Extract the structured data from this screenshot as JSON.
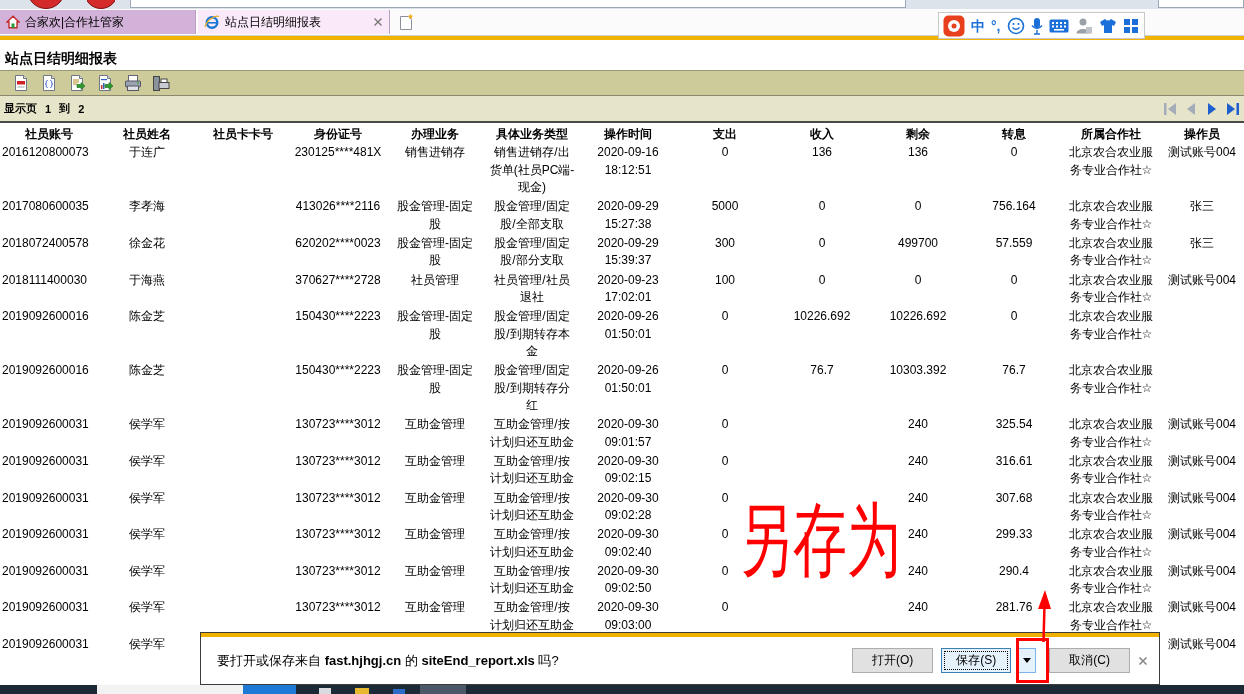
{
  "browser": {
    "tabs": [
      {
        "label": "合家欢|合作社管家",
        "selected": false
      },
      {
        "label": "站点日结明细报表",
        "selected": true
      }
    ]
  },
  "ime_bar": {
    "mode": "中",
    "punctuation": "°,"
  },
  "page_title": "站点日结明细报表",
  "pager": {
    "prefix": "显示页",
    "current": "1",
    "separator": "到",
    "total": "2",
    "nav": [
      {
        "kind": "first",
        "disabled": true
      },
      {
        "kind": "prev",
        "disabled": true
      },
      {
        "kind": "next",
        "disabled": false
      },
      {
        "kind": "last",
        "disabled": false
      }
    ]
  },
  "table": {
    "columns": [
      "社员账号",
      "社员姓名",
      "社员卡卡号",
      "身份证号",
      "办理业务",
      "具体业务类型",
      "操作时间",
      "支出",
      "收入",
      "剩余",
      "转息",
      "所属合作社",
      "操作员"
    ],
    "rows": [
      {
        "cells": [
          "2016120800073",
          "于连广",
          null,
          "230125****481X",
          "销售进销存",
          "销售进销存/出货单(社员PC端-现金)",
          "2020-09-16 18:12:51",
          "0",
          "136",
          "136",
          "0",
          "北京农合农业服务专业合作社☆",
          "测试账号004"
        ]
      },
      {
        "cells": [
          "2017080600035",
          "李孝海",
          null,
          "413026****2116",
          "股金管理-固定股",
          "股金管理/固定股/全部支取",
          "2020-09-29 15:27:38",
          "5000",
          "0",
          "0",
          "756.164",
          "北京农合农业服务专业合作社☆",
          "张三"
        ]
      },
      {
        "cells": [
          "2018072400578",
          "徐金花",
          null,
          "620202****0023",
          "股金管理-固定股",
          "股金管理/固定股/部分支取",
          "2020-09-29 15:39:37",
          "300",
          "0",
          "499700",
          "57.559",
          "北京农合农业服务专业合作社☆",
          "张三"
        ]
      },
      {
        "cells": [
          "2018111400030",
          "于海燕",
          null,
          "370627****2728",
          "社员管理",
          "社员管理/社员退社",
          "2020-09-23 17:02:01",
          "100",
          "0",
          "0",
          "0",
          "北京农合农业服务专业合作社☆",
          "测试账号004"
        ]
      },
      {
        "cells": [
          "2019092600016",
          "陈金芝",
          null,
          "150430****2223",
          "股金管理-固定股",
          "股金管理/固定股/到期转存本金",
          "2020-09-26 01:50:01",
          "0",
          "10226.692",
          "10226.692",
          "0",
          "北京农合农业服务专业合作社☆",
          null
        ]
      },
      {
        "cells": [
          "2019092600016",
          "陈金芝",
          null,
          "150430****2223",
          "股金管理-固定股",
          "股金管理/固定股/到期转存分红",
          "2020-09-26 01:50:01",
          "0",
          "76.7",
          "10303.392",
          "76.7",
          "北京农合农业服务专业合作社☆",
          null
        ]
      },
      {
        "cells": [
          "2019092600031",
          "侯学军",
          null,
          "130723****3012",
          "互助金管理",
          "互助金管理/按计划归还互助金",
          "2020-09-30 09:01:57",
          "0",
          null,
          "240",
          "325.54",
          "北京农合农业服务专业合作社☆",
          "测试账号004"
        ]
      },
      {
        "cells": [
          "2019092600031",
          "侯学军",
          null,
          "130723****3012",
          "互助金管理",
          "互助金管理/按计划归还互助金",
          "2020-09-30 09:02:15",
          "0",
          null,
          "240",
          "316.61",
          "北京农合农业服务专业合作社☆",
          "测试账号004"
        ]
      },
      {
        "cells": [
          "2019092600031",
          "侯学军",
          null,
          "130723****3012",
          "互助金管理",
          "互助金管理/按计划归还互助金",
          "2020-09-30 09:02:28",
          "0",
          null,
          "240",
          "307.68",
          "北京农合农业服务专业合作社☆",
          "测试账号004"
        ]
      },
      {
        "cells": [
          "2019092600031",
          "侯学军",
          null,
          "130723****3012",
          "互助金管理",
          "互助金管理/按计划归还互助金",
          "2020-09-30 09:02:40",
          "0",
          null,
          "240",
          "299.33",
          "北京农合农业服务专业合作社☆",
          "测试账号004"
        ]
      },
      {
        "cells": [
          "2019092600031",
          "侯学军",
          null,
          "130723****3012",
          "互助金管理",
          "互助金管理/按计划归还互助金",
          "2020-09-30 09:02:50",
          "0",
          null,
          "240",
          "290.4",
          "北京农合农业服务专业合作社☆",
          "测试账号004"
        ]
      },
      {
        "cells": [
          "2019092600031",
          "侯学军",
          null,
          "130723****3012",
          "互助金管理",
          "互助金管理/按计划归还互助金",
          "2020-09-30 09:03:00",
          "0",
          null,
          "240",
          "281.76",
          "北京农合农业服务专业合作社☆",
          "测试账号004"
        ]
      },
      {
        "cells": [
          "2019092600031",
          "侯学军",
          null,
          null,
          null,
          null,
          null,
          null,
          null,
          null,
          null,
          null,
          "测试账号004"
        ]
      }
    ]
  },
  "download_bar": {
    "message": "要打开或保存来自 **fast.hjhgj.cn** 的 **siteEnd_report.xls** 吗?",
    "buttons": [
      {
        "label": "打开(O)",
        "kind": "plain",
        "focused": false
      },
      {
        "label": "保存(S)",
        "kind": "split",
        "focused": true
      },
      {
        "label": "取消(C)",
        "kind": "plain",
        "focused": false
      }
    ]
  },
  "annotation": {
    "text": "另存为"
  }
}
